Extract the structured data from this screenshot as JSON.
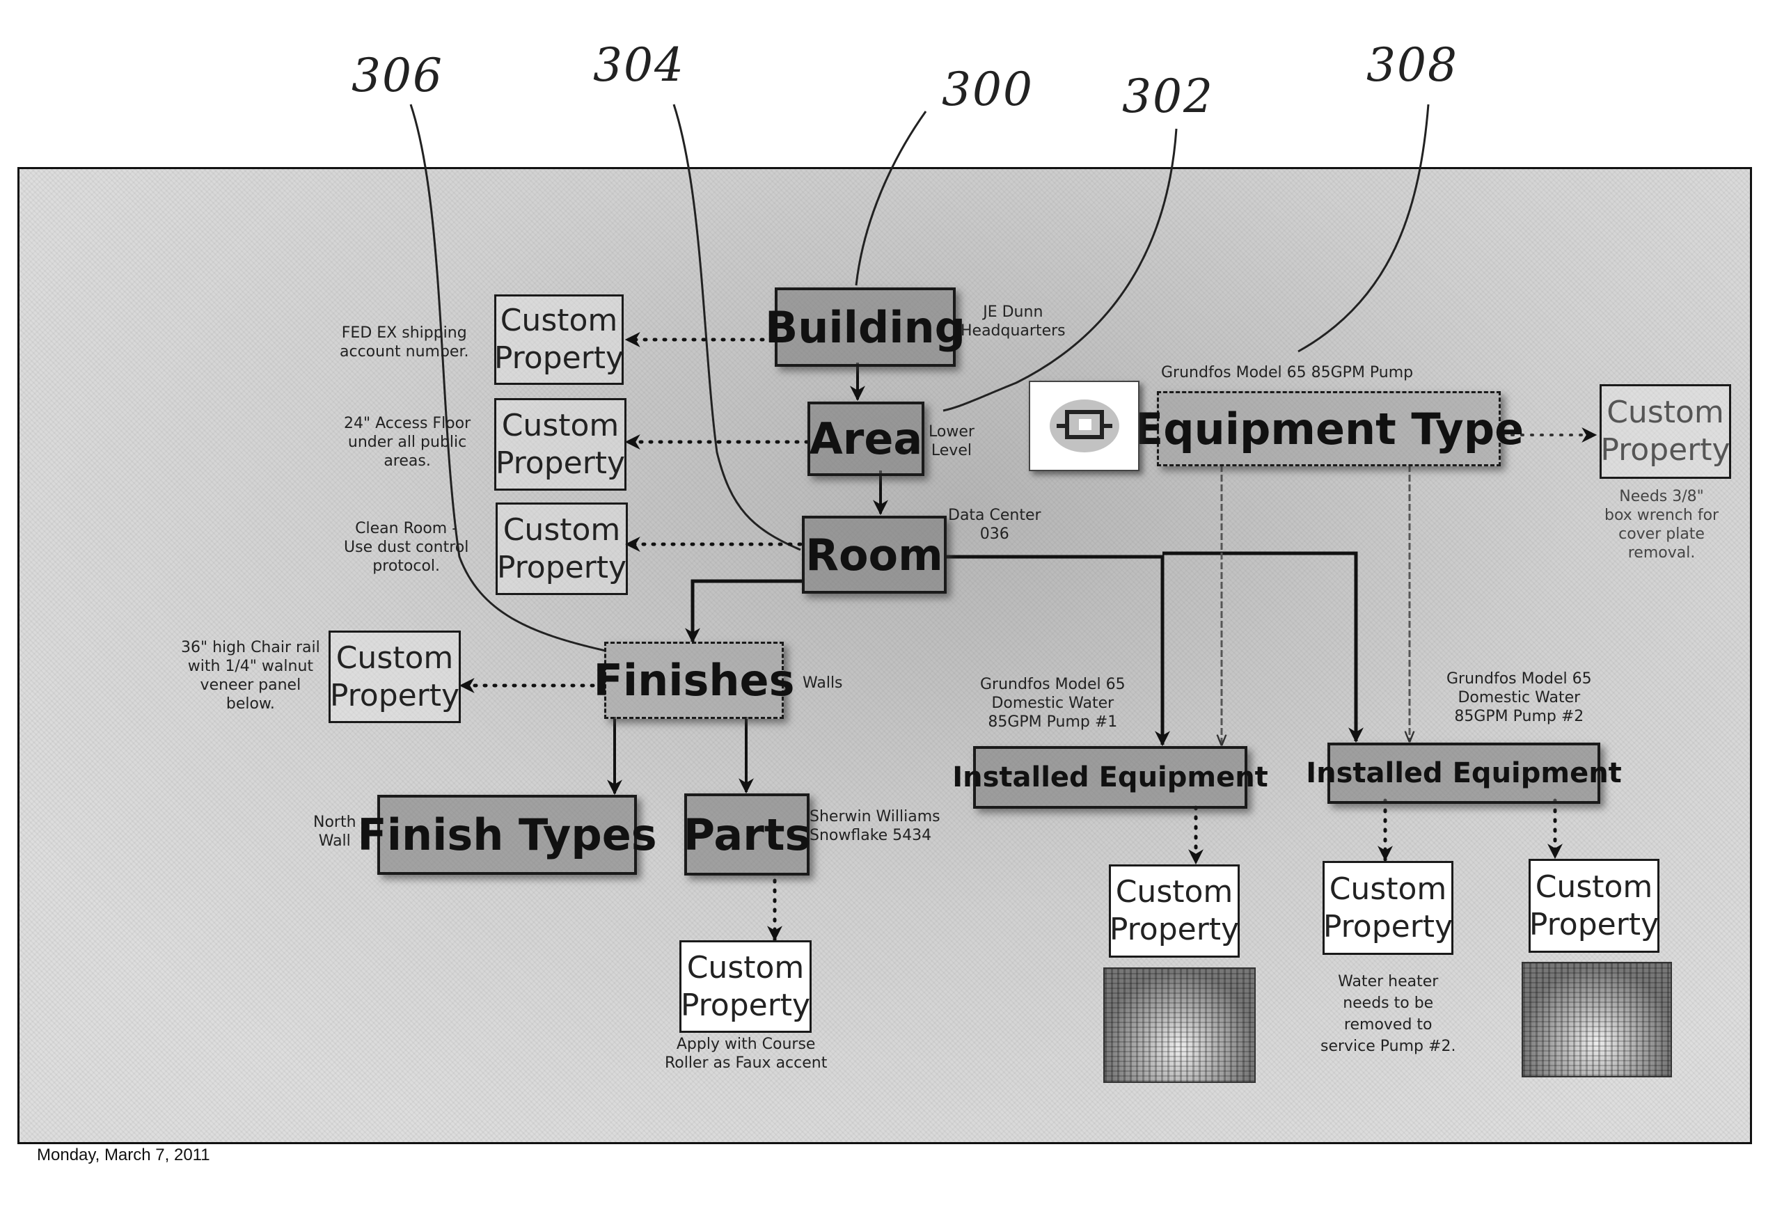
{
  "reference_numerals": {
    "r306": "306",
    "r304": "304",
    "r300": "300",
    "r302": "302",
    "r308": "308"
  },
  "nodes": {
    "building": "Building",
    "area": "Area",
    "room": "Room",
    "finishes": "Finishes",
    "finish_types": "Finish Types",
    "parts": "Parts",
    "equipment_type": "Equipment Type",
    "installed_equipment_1": "Installed Equipment",
    "installed_equipment_2": "Installed Equipment"
  },
  "custom_property": {
    "line1": "Custom",
    "line2": "Property"
  },
  "annotations": {
    "building_value": [
      "JE Dunn",
      "Headquarters"
    ],
    "area_value": [
      "Lower",
      "Level"
    ],
    "room_value": [
      "Data Center",
      "036"
    ],
    "finishes_value": "Walls",
    "finish_types_value": [
      "North",
      "Wall"
    ],
    "parts_value": [
      "Sherwin Williams",
      "Snowflake 5434"
    ],
    "equipment_type_value": "Grundfos Model 65 85GPM Pump",
    "installed_1_value": [
      "Grundfos Model 65",
      "Domestic Water",
      "85GPM Pump #1"
    ],
    "installed_2_value": [
      "Grundfos Model 65",
      "Domestic Water",
      "85GPM Pump #2"
    ],
    "building_prop_note": [
      "FED EX shipping",
      "account number."
    ],
    "area_prop_note": [
      "24\" Access Floor",
      "under all public",
      "areas."
    ],
    "room_prop_note": [
      "Clean Room -",
      "Use dust control",
      "protocol."
    ],
    "finishes_prop_note": [
      "36\" high Chair rail",
      "with 1/4\" walnut",
      "veneer panel",
      "below."
    ],
    "parts_prop_note": [
      "Apply with Course",
      "Roller as Faux accent"
    ],
    "equipment_type_prop_note": [
      "Needs 3/8\"",
      "box wrench for",
      "cover plate",
      "removal."
    ],
    "installed_2_prop_note": [
      "Water heater",
      "needs to be",
      "removed to",
      "service Pump #2."
    ]
  },
  "footer": {
    "date": "Monday, March 7, 2011"
  }
}
